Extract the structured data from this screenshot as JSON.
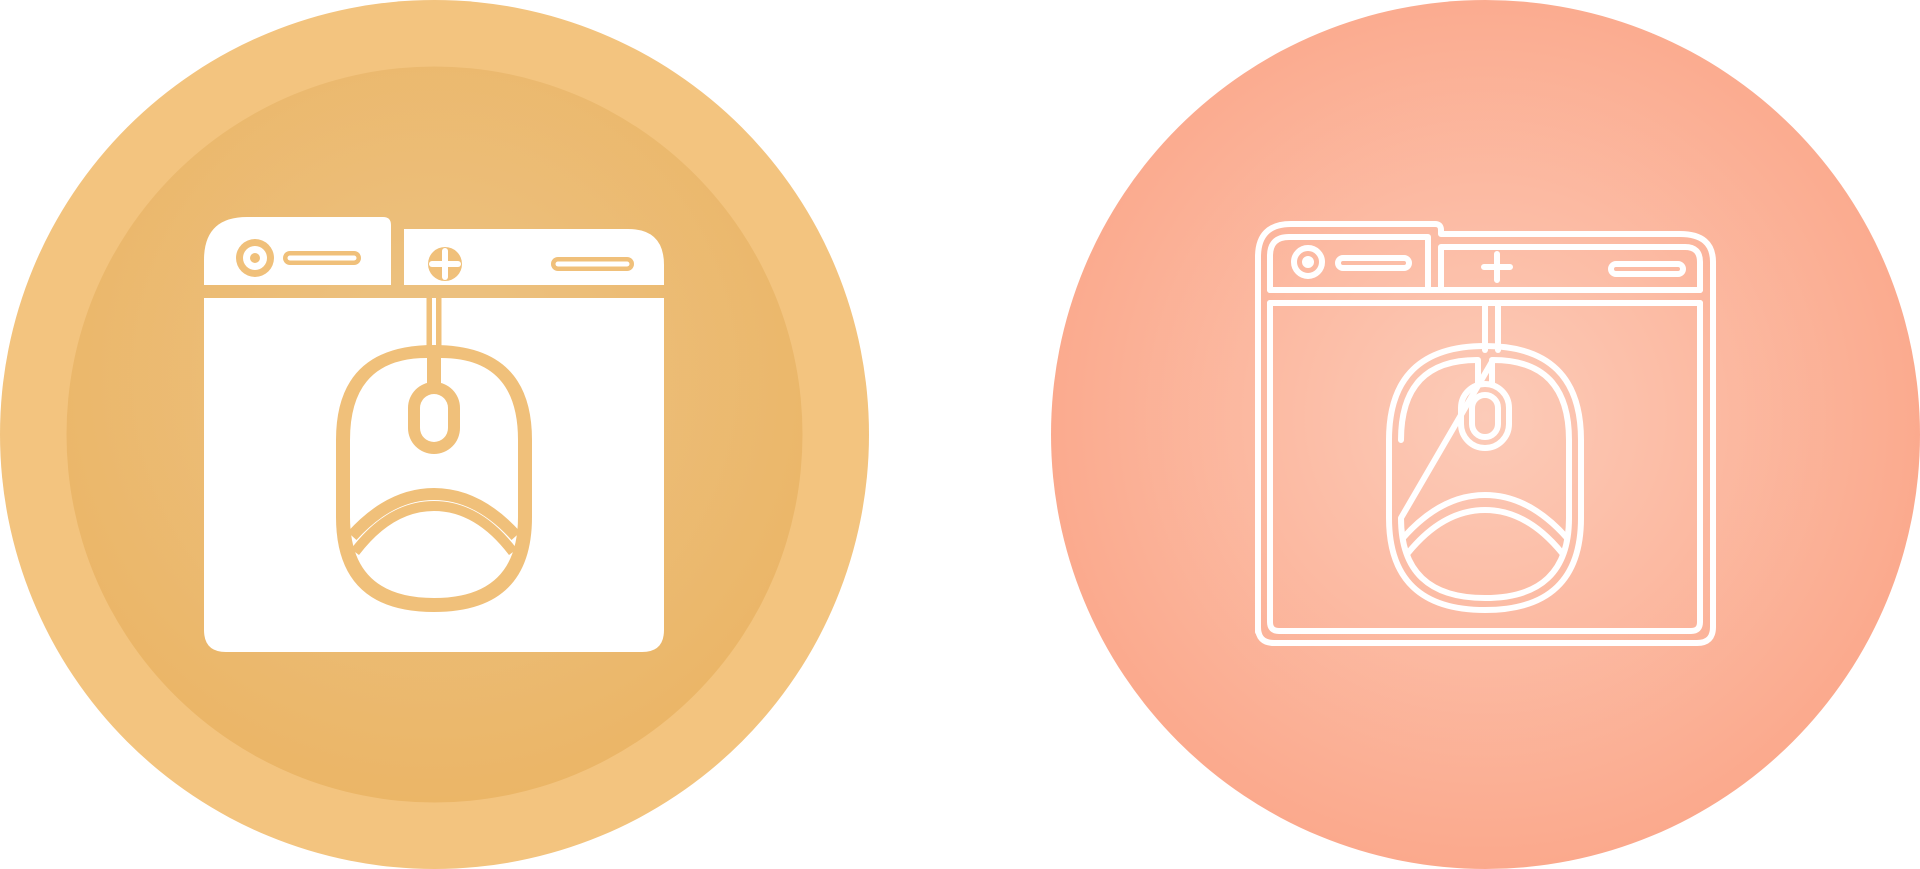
{
  "icons": [
    {
      "name": "browser-mouse-click-icon",
      "style": "glyph",
      "colors": {
        "outer": "#F3C47F",
        "inner_center": "#ECC384",
        "inner_edge": "#EBB566",
        "foreground": "#FFFFFF",
        "detail": "#F0C07A"
      }
    },
    {
      "name": "browser-mouse-click-icon",
      "style": "line",
      "colors": {
        "center": "#FCCBB8",
        "edge": "#FBA78A",
        "foreground": "#FFFFFF"
      }
    }
  ]
}
